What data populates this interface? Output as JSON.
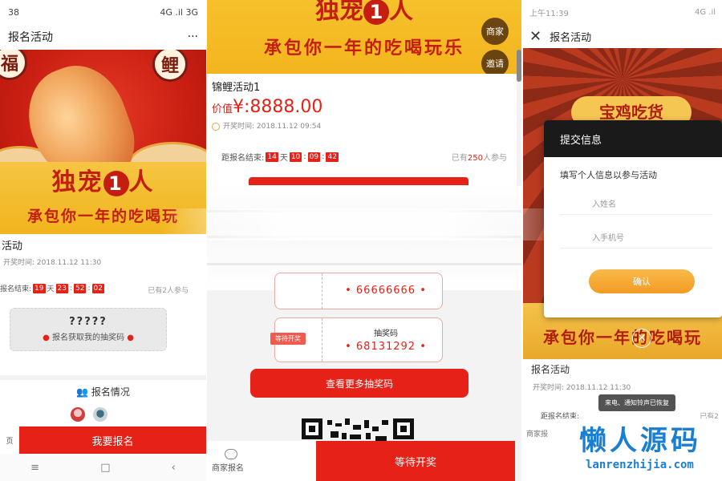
{
  "phone1": {
    "status_time": "38",
    "status_signal": "4G .il 3G",
    "title": "报名活动",
    "menu": "···",
    "poster": {
      "seal_left": "福",
      "seal_right": "鲤",
      "slogan_big_a": "独宠",
      "slogan_big_one": "1",
      "slogan_big_b": "人",
      "slogan_small": "承包你一年的吃喝玩"
    },
    "activity_name": "活动",
    "draw_time": "开奖时间: 2018.11.12 11:30",
    "countdown_label": "报名结束:",
    "countdown": {
      "days": "19",
      "day_unit": "天",
      "hours": "23",
      "minutes": "52",
      "seconds": "02"
    },
    "joined": "已有2人参与",
    "ticket_code": "?????",
    "ticket_text": "报名获取我的抽奖码",
    "signup_status": "报名情况",
    "bottom_left": "页",
    "signup_button": "我要报名",
    "nav": [
      "≡",
      "□",
      "‹"
    ]
  },
  "phone2": {
    "poster": {
      "big_a": "独宠",
      "big_one": "1",
      "big_b": "人",
      "small": "承包你一年的吃喝玩乐"
    },
    "merchant_btn": "商家",
    "invite_btn": "邀请",
    "activity_name": "锦鲤活动1",
    "price_label": "价值",
    "price": "¥:8888.00",
    "draw_time": "开奖时间: 2018.11.12 09:54",
    "countdown_label": "距报名结束:",
    "countdown": {
      "days": "14",
      "day_unit": "天",
      "hours": "10",
      "minutes": "09",
      "seconds": "42"
    },
    "joined_prefix": "已有",
    "joined_num": "250",
    "joined_suffix": "人参与",
    "card_top_code": "• 66666666 •",
    "card_tag": "等待开奖",
    "card_label": "抽奖码",
    "card_code": "• 68131292 •",
    "more_button": "查看更多抽奖码",
    "shop_label": "商家报名",
    "wait_button": "等待开奖"
  },
  "phone3": {
    "status_time": "上午11:39",
    "status_signal": "4G .il",
    "title": "报名活动",
    "poster_brand": "宝鸡吃货",
    "poster_slogan": "承包你一年的吃喝玩",
    "modal": {
      "title": "提交信息",
      "hint": "填写个人信息以参与活动",
      "name_placeholder": "入姓名",
      "phone_placeholder": "入手机号",
      "confirm": "确认"
    },
    "activity_name": "报名活动",
    "draw_time": "开奖时间: 2018.11.12 11:30",
    "toast": "来电、通知铃声已恢复",
    "countdown_label": "距报名结束:",
    "joined": "已有2",
    "shop_label": "商家报"
  },
  "watermark": {
    "cn": "懒人源码",
    "en": "lanrenzhijia.com"
  },
  "colors": {
    "primary_red": "#e62117",
    "gold": "#f3b51e",
    "orange_button": "#f39c24",
    "watermark_blue": "#1a7fd0"
  }
}
